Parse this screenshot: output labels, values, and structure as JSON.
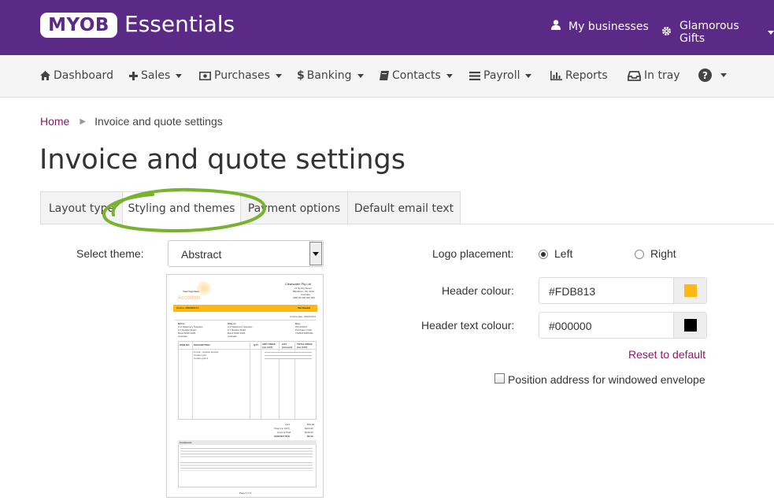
{
  "header": {
    "brand_myob": "MYOB",
    "brand_product": "Essentials",
    "my_businesses": "My businesses",
    "business_name": "Glamorous Gifts",
    "bg_color": "#5b2a86"
  },
  "nav": {
    "dashboard": "Dashboard",
    "sales": "Sales",
    "purchases": "Purchases",
    "banking": "Banking",
    "contacts": "Contacts",
    "payroll": "Payroll",
    "reports": "Reports",
    "in_tray": "In tray",
    "help_icon": "question-circle-icon"
  },
  "breadcrumb": {
    "home": "Home",
    "current": "Invoice and quote settings"
  },
  "page_title": "Invoice and quote settings",
  "tabs": [
    {
      "label": "Layout type",
      "active": false
    },
    {
      "label": "Styling and themes",
      "active": true
    },
    {
      "label": "Payment options",
      "active": false
    },
    {
      "label": "Default email text",
      "active": false
    }
  ],
  "theme": {
    "label": "Select theme:",
    "value": "Abstract"
  },
  "preview": {
    "company": "Clearwater Pty Ltd",
    "addr1": "12 Spring Street",
    "addr2": "Blackburn, Vic 3130",
    "addr3": "Australia",
    "abn": "ABN 00 000 000 000",
    "logo": "Your logo here",
    "watermark": "Accounts",
    "doc_type": "Tax Invoice",
    "invoice_no_label": "Invoice: 00000001XX",
    "invoice_date": "Invoice date: 22/10/2013",
    "bill_to": "Bill to:",
    "ship_to": "Ship to:",
    "due": "Due:",
    "customer1": "A-Z Stationery Supplies",
    "customer2": "3-7 Reader Road",
    "customer3": "Bond NSW 2026",
    "customer4": "Australia",
    "due_date": "22/10/2013",
    "po_label": "Purchase Order",
    "po_value": "TKZ947498729A",
    "col_item": "ITEM NO.",
    "col_desc": "DESCRIPTION",
    "col_qty": "QTY",
    "col_unit": "UNIT PRICE (inc GST)",
    "col_gst": "GST (Amount)",
    "col_total": "TOTAL PRICE (inc GST)",
    "row1": "1 hour - Courier service",
    "row2": "Courier part",
    "row3": "Courier part 2",
    "gst_label": "GST",
    "gst_val": "$20.00",
    "total_label": "Total (inc GST)",
    "total_val": "$220.00",
    "paid_label": "Amount Paid",
    "paid_val": "$120.00",
    "due_label": "AMOUNT DUE",
    "due_val": "$0.00",
    "comments": "Comments",
    "page": "Page 1 of 1",
    "header_color": "#fdb813"
  },
  "logo_placement": {
    "label": "Logo placement:",
    "left": "Left",
    "right": "Right",
    "selected": "Left"
  },
  "header_colour": {
    "label": "Header colour:",
    "value": "#FDB813",
    "swatch": "#FDB813"
  },
  "header_text_colour": {
    "label": "Header text colour:",
    "value": "#000000",
    "swatch": "#000000"
  },
  "reset_label": "Reset to default",
  "windowed_envelope": {
    "label": "Position address for windowed envelope",
    "checked": false
  }
}
